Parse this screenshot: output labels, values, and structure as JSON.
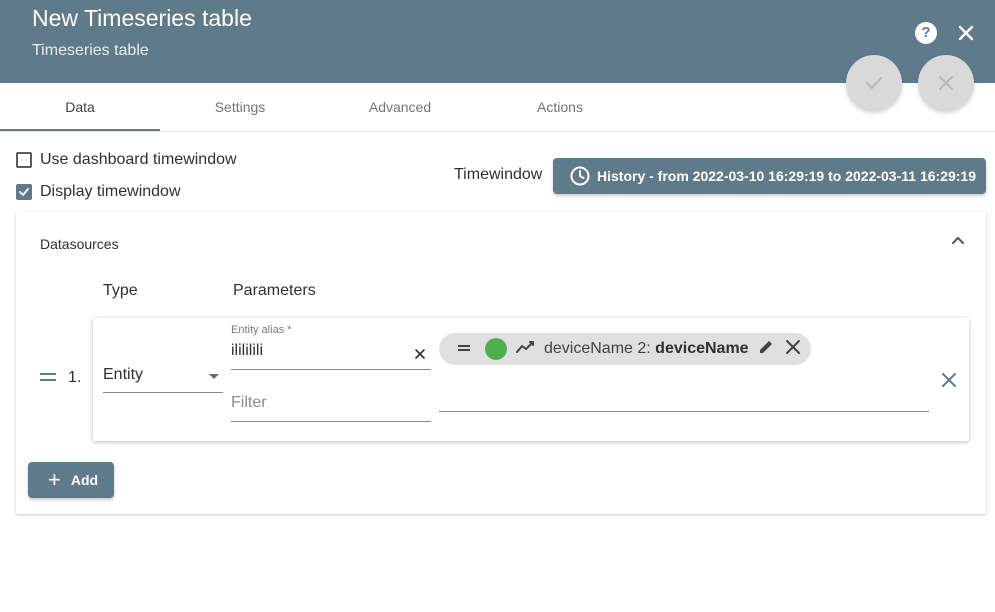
{
  "header": {
    "title": "New Timeseries table",
    "subtitle": "Timeseries table",
    "help_icon": "help-circle-icon",
    "close_icon": "close-icon",
    "help_glyph": "?"
  },
  "fabs": {
    "apply_icon": "check-icon",
    "cancel_icon": "close-icon"
  },
  "tabs": [
    {
      "label": "Data",
      "active": true
    },
    {
      "label": "Settings",
      "active": false
    },
    {
      "label": "Advanced",
      "active": false
    },
    {
      "label": "Actions",
      "active": false
    }
  ],
  "options": {
    "use_dashboard_timewindow": {
      "label": "Use dashboard timewindow",
      "checked": false
    },
    "display_timewindow": {
      "label": "Display timewindow",
      "checked": true
    }
  },
  "timewindow": {
    "label": "Timewindow",
    "button_text": "History - from 2022-03-10 16:29:19 to 2022-03-11 16:29:19",
    "icon": "clock-icon"
  },
  "datasources": {
    "title": "Datasources",
    "collapse_icon": "chevron-up-icon",
    "columns": {
      "type": "Type",
      "parameters": "Parameters"
    },
    "rows": [
      {
        "index": "1.",
        "type": "Entity",
        "entity_alias_label": "Entity alias *",
        "entity_alias_value": "ilililili",
        "filter_placeholder": "Filter",
        "key_chip": {
          "color": "#4caf50",
          "label": "deviceName 2:",
          "key": "deviceName",
          "type_icon": "timeseries-icon"
        }
      }
    ],
    "add_label": "Add"
  },
  "colors": {
    "primary": "#5f7a8b",
    "fab_bg": "#d9d9d9",
    "chip_bg": "#e0e0e0"
  }
}
